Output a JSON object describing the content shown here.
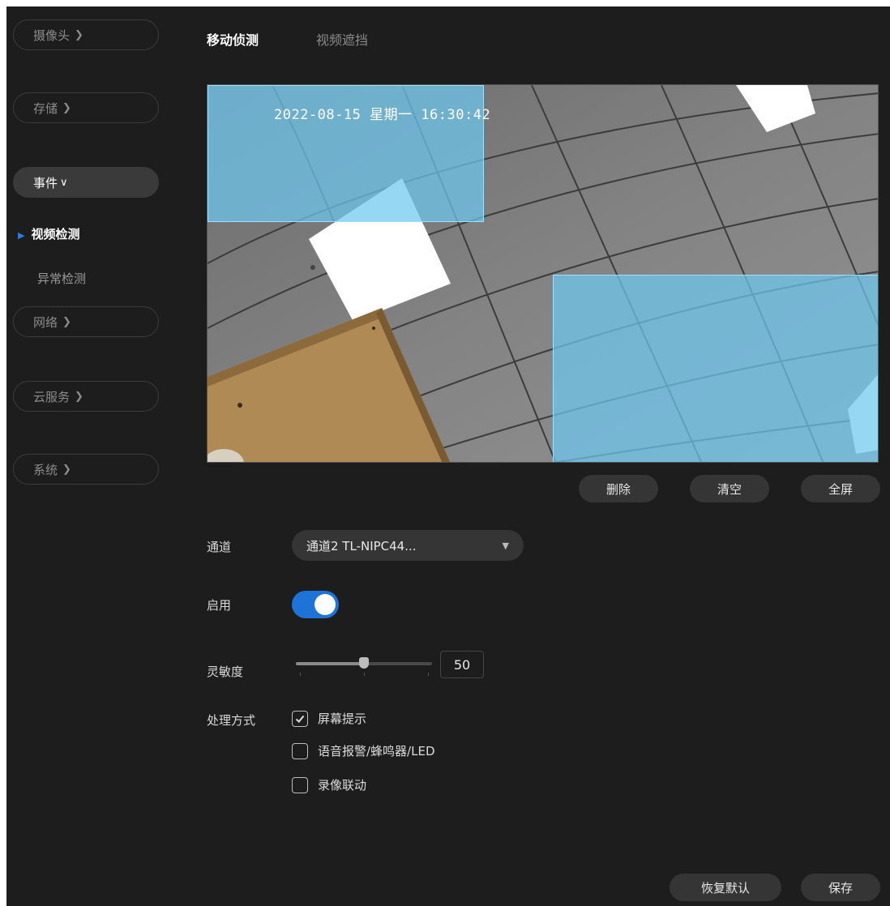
{
  "sidebar": {
    "nav": [
      {
        "label": "摄像头",
        "chevron": "chevron-right-icon"
      },
      {
        "label": "存储",
        "chevron": "chevron-right-icon"
      },
      {
        "label": "事件",
        "chevron": "chevron-down-icon"
      },
      {
        "label": "网络",
        "chevron": "chevron-right-icon"
      },
      {
        "label": "云服务",
        "chevron": "chevron-right-icon"
      },
      {
        "label": "系统",
        "chevron": "chevron-right-icon"
      }
    ],
    "sub_items": [
      {
        "label": "视频检测",
        "current": true
      },
      {
        "label": "异常检测",
        "current": false
      }
    ]
  },
  "tabs": [
    {
      "label": "移动侦测",
      "active": true
    },
    {
      "label": "视频遮挡",
      "active": false
    }
  ],
  "video": {
    "osd_text": "2022-08-15 星期一 16:30:42"
  },
  "video_buttons": {
    "delete": "删除",
    "clear": "清空",
    "fullscreen": "全屏"
  },
  "form": {
    "channel_label": "通道",
    "channel_value": "通道2 TL-NIPC44...",
    "enable_label": "启用",
    "enable_on": true,
    "sensitivity_label": "灵敏度",
    "sensitivity_value": "50",
    "sensitivity_fraction": 0.5,
    "action_label": "处理方式",
    "actions": [
      {
        "label": "屏幕提示",
        "checked": true
      },
      {
        "label": "语音报警/蜂鸣器/LED",
        "checked": false
      },
      {
        "label": "录像联动",
        "checked": false
      }
    ]
  },
  "footer": {
    "restore_default": "恢复默认",
    "save": "保存"
  },
  "colors": {
    "accent": "#1e73d8",
    "region_fill": "#6ec8f0",
    "background": "#1d1d1d"
  }
}
